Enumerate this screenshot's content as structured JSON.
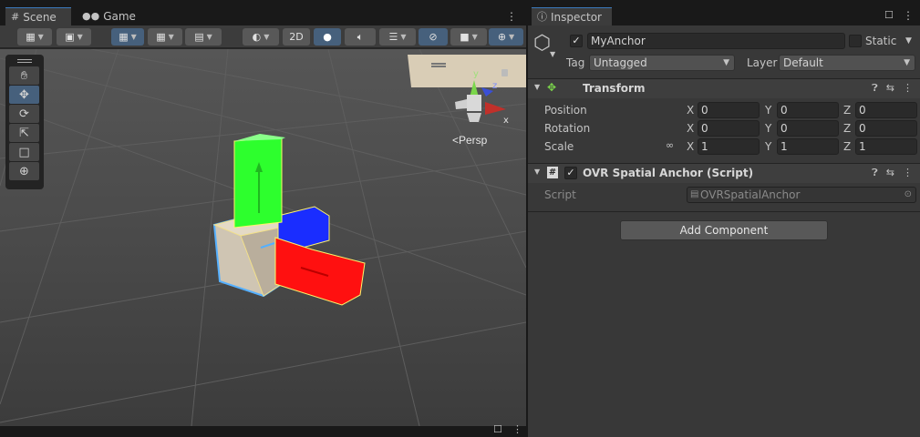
{
  "scene_tabs": [
    {
      "label": "Scene",
      "icon": "grid-icon"
    },
    {
      "label": "Game",
      "icon": "gamepad-icon"
    }
  ],
  "scene_toolbar": {
    "btn_2d": "2D"
  },
  "viewport": {
    "persp_label": "<Persp",
    "gizmo_x": "x",
    "gizmo_y": "y",
    "gizmo_z": "z"
  },
  "inspector": {
    "tab_label": "Inspector",
    "object_name": "MyAnchor",
    "static_label": "Static",
    "tag_label": "Tag",
    "tag_value": "Untagged",
    "layer_label": "Layer",
    "layer_value": "Default",
    "transform": {
      "title": "Transform",
      "rows": [
        {
          "label": "Position",
          "x": "0",
          "y": "0",
          "z": "0"
        },
        {
          "label": "Rotation",
          "x": "0",
          "y": "0",
          "z": "0"
        },
        {
          "label": "Scale",
          "x": "1",
          "y": "1",
          "z": "1"
        }
      ],
      "axis_x": "X",
      "axis_y": "Y",
      "axis_z": "Z"
    },
    "script_component": {
      "title": "OVR Spatial Anchor (Script)",
      "script_label": "Script",
      "script_value": "OVRSpatialAnchor"
    },
    "add_component_label": "Add Component"
  },
  "colors": {
    "selection_blue": "#46607c",
    "accent_tab": "#3a79bb",
    "cube_green": "#2bff2b",
    "cube_red": "#ff0b0b",
    "cube_blue": "#0a14ff"
  }
}
